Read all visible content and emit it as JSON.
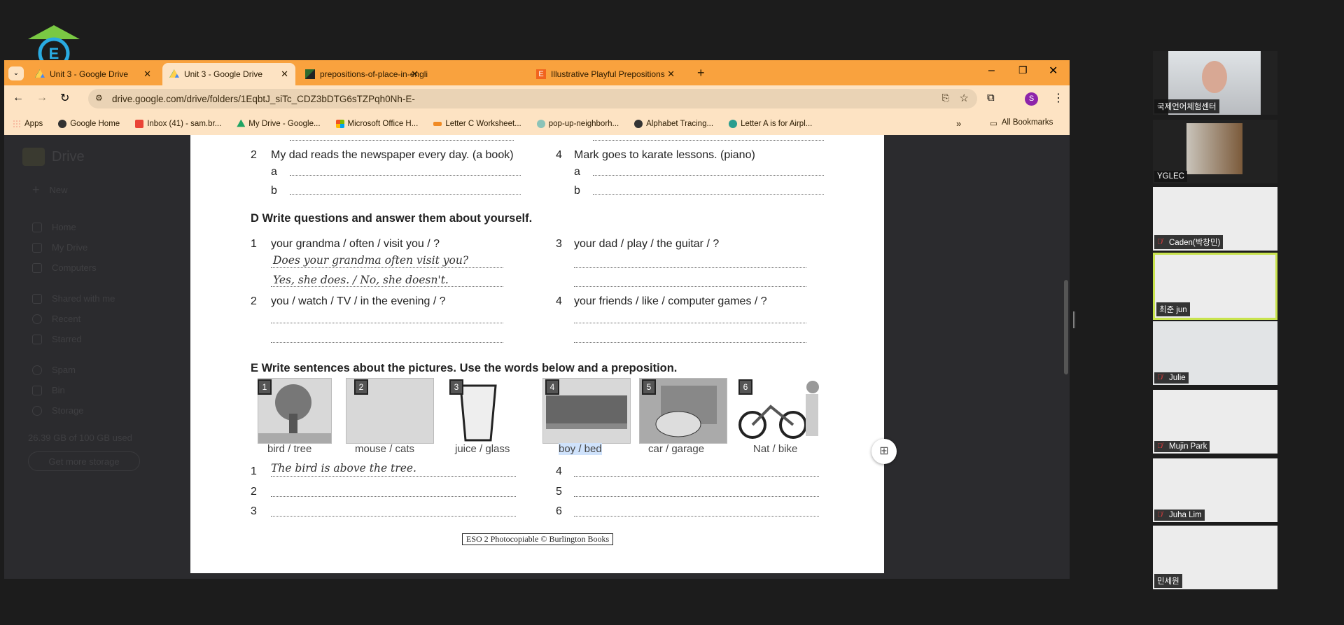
{
  "browser": {
    "tabs": [
      {
        "title": "Unit 3 - Google Drive",
        "active": false
      },
      {
        "title": "Unit 3 - Google Drive",
        "active": true
      },
      {
        "title": "prepositions-of-place-in-engli",
        "active": false
      },
      {
        "title": "Illustrative Playful Prepositions",
        "active": false
      }
    ],
    "new_tab": "+",
    "url": "drive.google.com/drive/folders/1EqbtJ_siTc_CDZ3bDTG6sTZPqh0Nh-E-",
    "profile_initial": "S",
    "bookmarks": [
      "Apps",
      "Google Home",
      "Inbox (41) - sam.br...",
      "My Drive - Google...",
      "Microsoft Office H...",
      "Letter C Worksheet...",
      "pop-up-neighborh...",
      "Alphabet Tracing...",
      "Letter A is for Airpl..."
    ],
    "all_bookmarks": "All Bookmarks",
    "accent": "#f9a23e"
  },
  "drive": {
    "brand": "Drive",
    "new": "New",
    "nav": [
      "Home",
      "My Drive",
      "Computers",
      "Shared with me",
      "Recent",
      "Starred",
      "Spam",
      "Bin",
      "Storage"
    ],
    "storage": "26.39 GB of 100 GB used",
    "get_storage": "Get more storage"
  },
  "worksheet": {
    "c_items": [
      {
        "num": "2",
        "text": "My dad reads the newspaper every day. (a book)"
      },
      {
        "num": "4",
        "text": "Mark goes to karate lessons. (piano)"
      }
    ],
    "letters": [
      "a",
      "b"
    ],
    "d_heading": "D  Write questions and answer them about yourself.",
    "d_items": [
      {
        "num": "1",
        "text": "your grandma / often / visit you / ?"
      },
      {
        "num": "3",
        "text": "your dad / play / the guitar / ?"
      },
      {
        "num": "2",
        "text": "you / watch / TV / in the evening / ?"
      },
      {
        "num": "4",
        "text": "your friends / like / computer games / ?"
      }
    ],
    "d_example_q": "Does your grandma often visit you?",
    "d_example_a": "Yes, she does. / No, she doesn't.",
    "e_heading": "E  Write sentences about the pictures. Use the words below and a preposition.",
    "pictures": [
      {
        "num": "1",
        "label": "bird / tree"
      },
      {
        "num": "2",
        "label": "mouse / cats"
      },
      {
        "num": "3",
        "label": "juice / glass"
      },
      {
        "num": "4",
        "label": "boy / bed"
      },
      {
        "num": "5",
        "label": "car / garage"
      },
      {
        "num": "6",
        "label": "Nat / bike"
      }
    ],
    "e_nums": [
      "1",
      "2",
      "3",
      "4",
      "5",
      "6"
    ],
    "e_example": "The bird is above the tree.",
    "footer": "ESO 2 Photocopiable © Burlington Books"
  },
  "participants": [
    {
      "name": "국제언어체험센터",
      "muted": false,
      "video": true
    },
    {
      "name": "YGLEC",
      "muted": false,
      "video": true
    },
    {
      "name": "Caden(박창민)",
      "muted": true
    },
    {
      "name": "최준 jun",
      "muted": false,
      "speaking": true
    },
    {
      "name": "Julie",
      "muted": true
    },
    {
      "name": "Mujin Park",
      "muted": true
    },
    {
      "name": "Juha Lim",
      "muted": true
    },
    {
      "name": "민세원",
      "muted": false
    }
  ]
}
